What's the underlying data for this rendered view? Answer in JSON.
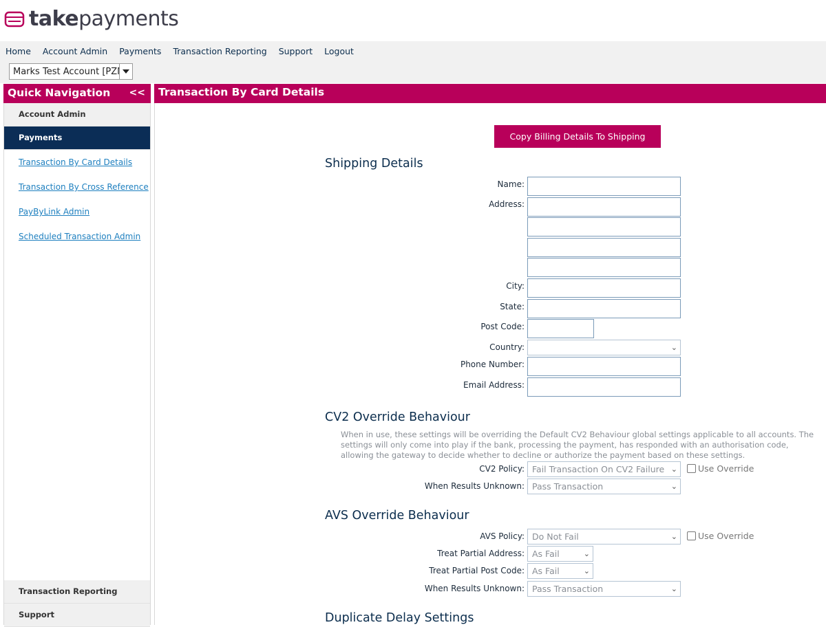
{
  "brand": {
    "logo_bold": "take",
    "logo_light": "payments",
    "accent": "#b8005a",
    "navy": "#0b2d56"
  },
  "menu": [
    "Home",
    "Account Admin",
    "Payments",
    "Transaction Reporting",
    "Support",
    "Logout"
  ],
  "account_select": {
    "value": "Marks Test Account [PZN"
  },
  "quick_nav": {
    "title": "Quick Navigation",
    "collapse": "<<"
  },
  "page_title": "Transaction By Card Details",
  "sidebar": {
    "sections_top": [
      "Account Admin",
      "Payments"
    ],
    "links": [
      "Transaction By Card Details",
      "Transaction By Cross Reference",
      "PayByLink Admin",
      "Scheduled Transaction Admin"
    ],
    "sections_bottom": [
      "Transaction Reporting",
      "Support"
    ]
  },
  "copy_button": "Copy Billing Details To Shipping",
  "shipping": {
    "title": "Shipping Details",
    "name": "Name:",
    "address": "Address:",
    "city": "City:",
    "state": "State:",
    "post_code": "Post Code:",
    "country": "Country:",
    "phone": "Phone Number:",
    "email": "Email Address:"
  },
  "cv2": {
    "title": "CV2 Override Behaviour",
    "description": "When in use, these settings will be overriding the Default CV2 Behaviour global settings applicable to all accounts. The settings will only come into play if the bank, processing the payment, has responded with an authorisation code, allowing the gateway to decide whether to decline or authorize the payment based on these settings.",
    "policy_label": "CV2 Policy:",
    "policy_value": "Fail Transaction On CV2 Failure",
    "override_label": "Use Override",
    "unknown_label": "When Results Unknown:",
    "unknown_value": "Pass Transaction"
  },
  "avs": {
    "title": "AVS Override Behaviour",
    "policy_label": "AVS Policy:",
    "policy_value": "Do Not Fail",
    "override_label": "Use Override",
    "partial_address_label": "Treat Partial Address:",
    "partial_address_value": "As Fail",
    "partial_post_label": "Treat Partial Post Code:",
    "partial_post_value": "As Fail",
    "unknown_label": "When Results Unknown:",
    "unknown_value": "Pass Transaction"
  },
  "duplicate": {
    "title": "Duplicate Delay Settings"
  }
}
